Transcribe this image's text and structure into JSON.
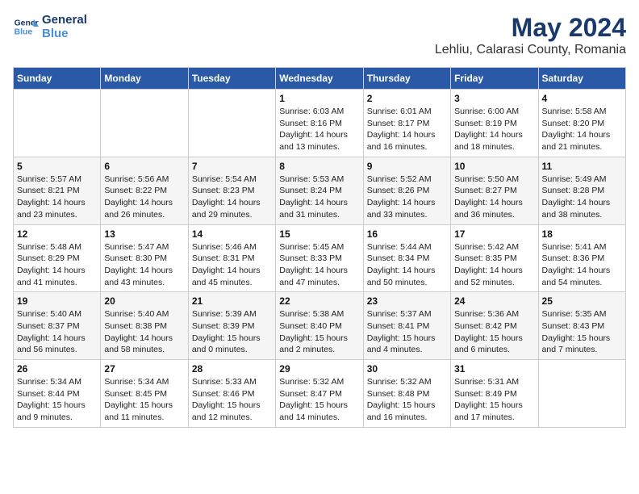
{
  "logo": {
    "line1": "General",
    "line2": "Blue"
  },
  "title": "May 2024",
  "subtitle": "Lehliu, Calarasi County, Romania",
  "weekdays": [
    "Sunday",
    "Monday",
    "Tuesday",
    "Wednesday",
    "Thursday",
    "Friday",
    "Saturday"
  ],
  "weeks": [
    [
      {
        "day": "",
        "info": ""
      },
      {
        "day": "",
        "info": ""
      },
      {
        "day": "",
        "info": ""
      },
      {
        "day": "1",
        "info": "Sunrise: 6:03 AM\nSunset: 8:16 PM\nDaylight: 14 hours\nand 13 minutes."
      },
      {
        "day": "2",
        "info": "Sunrise: 6:01 AM\nSunset: 8:17 PM\nDaylight: 14 hours\nand 16 minutes."
      },
      {
        "day": "3",
        "info": "Sunrise: 6:00 AM\nSunset: 8:19 PM\nDaylight: 14 hours\nand 18 minutes."
      },
      {
        "day": "4",
        "info": "Sunrise: 5:58 AM\nSunset: 8:20 PM\nDaylight: 14 hours\nand 21 minutes."
      }
    ],
    [
      {
        "day": "5",
        "info": "Sunrise: 5:57 AM\nSunset: 8:21 PM\nDaylight: 14 hours\nand 23 minutes."
      },
      {
        "day": "6",
        "info": "Sunrise: 5:56 AM\nSunset: 8:22 PM\nDaylight: 14 hours\nand 26 minutes."
      },
      {
        "day": "7",
        "info": "Sunrise: 5:54 AM\nSunset: 8:23 PM\nDaylight: 14 hours\nand 29 minutes."
      },
      {
        "day": "8",
        "info": "Sunrise: 5:53 AM\nSunset: 8:24 PM\nDaylight: 14 hours\nand 31 minutes."
      },
      {
        "day": "9",
        "info": "Sunrise: 5:52 AM\nSunset: 8:26 PM\nDaylight: 14 hours\nand 33 minutes."
      },
      {
        "day": "10",
        "info": "Sunrise: 5:50 AM\nSunset: 8:27 PM\nDaylight: 14 hours\nand 36 minutes."
      },
      {
        "day": "11",
        "info": "Sunrise: 5:49 AM\nSunset: 8:28 PM\nDaylight: 14 hours\nand 38 minutes."
      }
    ],
    [
      {
        "day": "12",
        "info": "Sunrise: 5:48 AM\nSunset: 8:29 PM\nDaylight: 14 hours\nand 41 minutes."
      },
      {
        "day": "13",
        "info": "Sunrise: 5:47 AM\nSunset: 8:30 PM\nDaylight: 14 hours\nand 43 minutes."
      },
      {
        "day": "14",
        "info": "Sunrise: 5:46 AM\nSunset: 8:31 PM\nDaylight: 14 hours\nand 45 minutes."
      },
      {
        "day": "15",
        "info": "Sunrise: 5:45 AM\nSunset: 8:33 PM\nDaylight: 14 hours\nand 47 minutes."
      },
      {
        "day": "16",
        "info": "Sunrise: 5:44 AM\nSunset: 8:34 PM\nDaylight: 14 hours\nand 50 minutes."
      },
      {
        "day": "17",
        "info": "Sunrise: 5:42 AM\nSunset: 8:35 PM\nDaylight: 14 hours\nand 52 minutes."
      },
      {
        "day": "18",
        "info": "Sunrise: 5:41 AM\nSunset: 8:36 PM\nDaylight: 14 hours\nand 54 minutes."
      }
    ],
    [
      {
        "day": "19",
        "info": "Sunrise: 5:40 AM\nSunset: 8:37 PM\nDaylight: 14 hours\nand 56 minutes."
      },
      {
        "day": "20",
        "info": "Sunrise: 5:40 AM\nSunset: 8:38 PM\nDaylight: 14 hours\nand 58 minutes."
      },
      {
        "day": "21",
        "info": "Sunrise: 5:39 AM\nSunset: 8:39 PM\nDaylight: 15 hours\nand 0 minutes."
      },
      {
        "day": "22",
        "info": "Sunrise: 5:38 AM\nSunset: 8:40 PM\nDaylight: 15 hours\nand 2 minutes."
      },
      {
        "day": "23",
        "info": "Sunrise: 5:37 AM\nSunset: 8:41 PM\nDaylight: 15 hours\nand 4 minutes."
      },
      {
        "day": "24",
        "info": "Sunrise: 5:36 AM\nSunset: 8:42 PM\nDaylight: 15 hours\nand 6 minutes."
      },
      {
        "day": "25",
        "info": "Sunrise: 5:35 AM\nSunset: 8:43 PM\nDaylight: 15 hours\nand 7 minutes."
      }
    ],
    [
      {
        "day": "26",
        "info": "Sunrise: 5:34 AM\nSunset: 8:44 PM\nDaylight: 15 hours\nand 9 minutes."
      },
      {
        "day": "27",
        "info": "Sunrise: 5:34 AM\nSunset: 8:45 PM\nDaylight: 15 hours\nand 11 minutes."
      },
      {
        "day": "28",
        "info": "Sunrise: 5:33 AM\nSunset: 8:46 PM\nDaylight: 15 hours\nand 12 minutes."
      },
      {
        "day": "29",
        "info": "Sunrise: 5:32 AM\nSunset: 8:47 PM\nDaylight: 15 hours\nand 14 minutes."
      },
      {
        "day": "30",
        "info": "Sunrise: 5:32 AM\nSunset: 8:48 PM\nDaylight: 15 hours\nand 16 minutes."
      },
      {
        "day": "31",
        "info": "Sunrise: 5:31 AM\nSunset: 8:49 PM\nDaylight: 15 hours\nand 17 minutes."
      },
      {
        "day": "",
        "info": ""
      }
    ]
  ]
}
